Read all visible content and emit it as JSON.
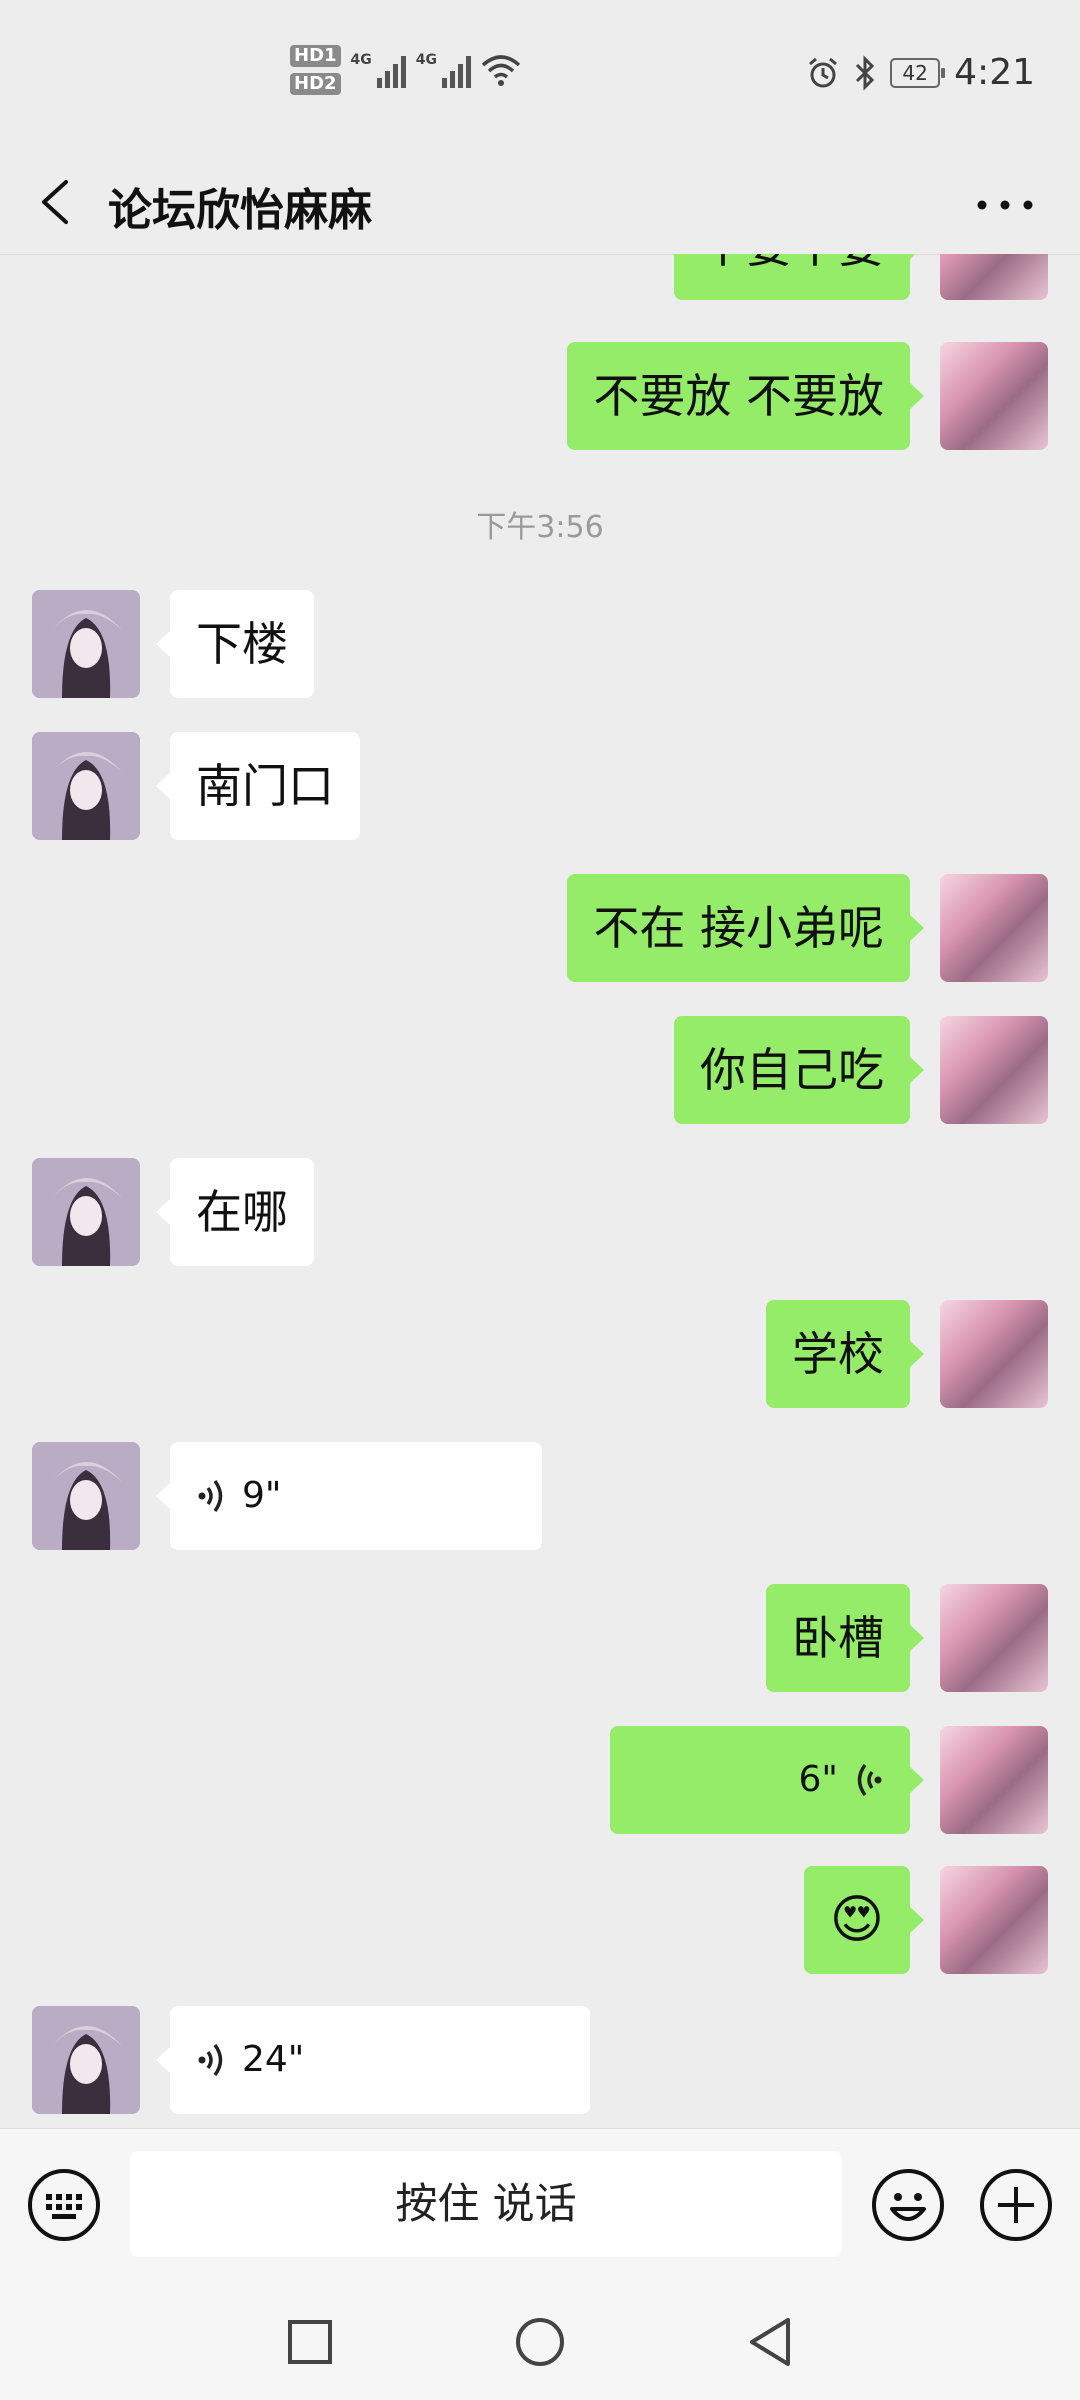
{
  "status_bar": {
    "hd1": "HD1",
    "hd2": "HD2",
    "net1": "4G",
    "net2": "4G",
    "battery": "42",
    "time": "4:21"
  },
  "header": {
    "title": "论坛欣怡麻麻",
    "back_icon": "back-chevron-icon",
    "more_icon": "more-dots-icon"
  },
  "messages": [
    {
      "from": "me",
      "text": "不要不要"
    },
    {
      "from": "me",
      "text": "不要放 不要放"
    },
    {
      "type": "time",
      "text": "下午3:56"
    },
    {
      "from": "them",
      "text": "下楼"
    },
    {
      "from": "them",
      "text": "南门口"
    },
    {
      "from": "me",
      "text": "不在 接小弟呢"
    },
    {
      "from": "me",
      "text": "你自己吃"
    },
    {
      "from": "them",
      "text": "在哪"
    },
    {
      "from": "me",
      "text": "学校"
    },
    {
      "from": "them",
      "voice": "9\""
    },
    {
      "from": "me",
      "text": "卧槽"
    },
    {
      "from": "me",
      "voice": "6\""
    },
    {
      "from": "me",
      "emoji": "😍"
    },
    {
      "from": "them",
      "voice": "24\""
    }
  ],
  "input_bar": {
    "hold_to_talk": "按住 说话",
    "keyboard_icon": "keyboard-icon",
    "emoji_icon": "emoji-icon",
    "plus_icon": "plus-icon"
  },
  "colors": {
    "background": "#ededed",
    "my_bubble": "#95ec69",
    "their_bubble": "#ffffff"
  }
}
